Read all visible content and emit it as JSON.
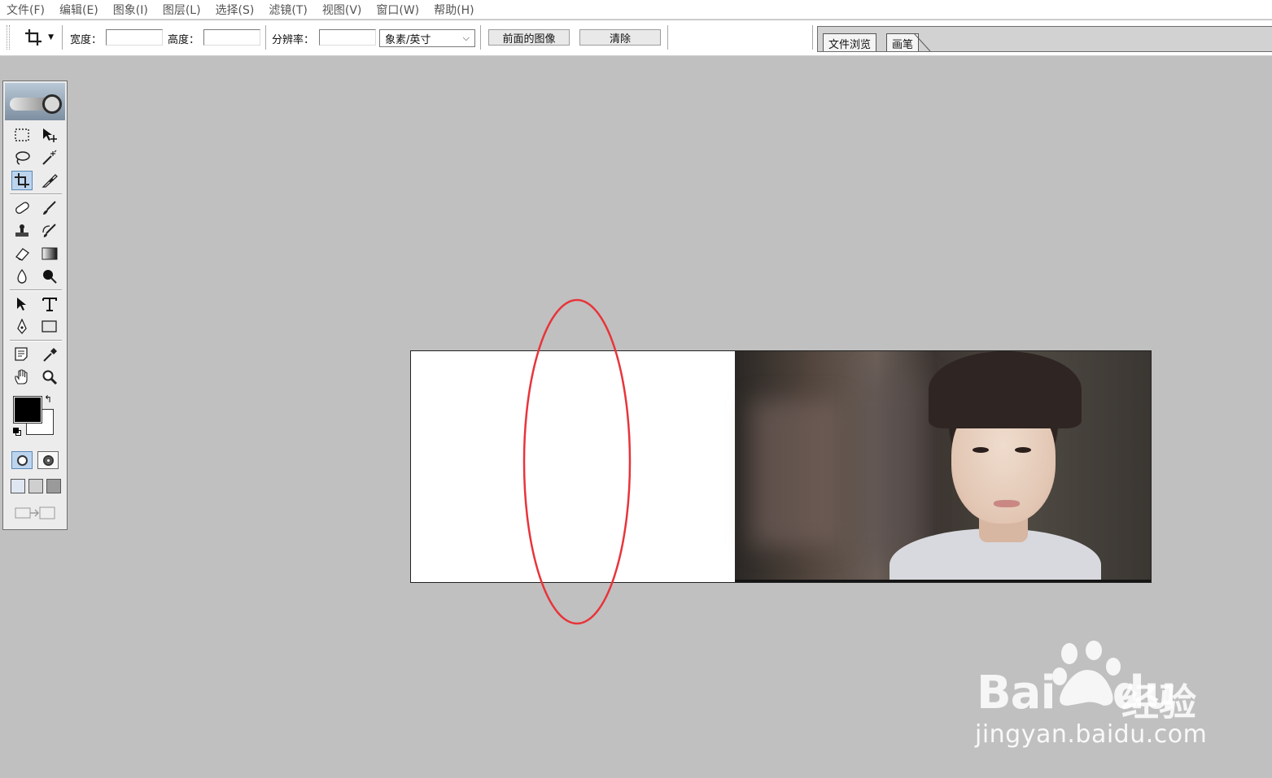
{
  "menubar": {
    "items": [
      "文件(F)",
      "编辑(E)",
      "图象(I)",
      "图层(L)",
      "选择(S)",
      "滤镜(T)",
      "视图(V)",
      "窗口(W)",
      "帮助(H)"
    ]
  },
  "options": {
    "tool_icon": "crop-icon",
    "width_label": "宽度：",
    "width_value": "",
    "height_label": "高度：",
    "height_value": "",
    "resolution_label": "分辨率：",
    "resolution_value": "",
    "unit_select": "象素/英寸",
    "front_image_button": "前面的图像",
    "clear_button": "清除"
  },
  "palette_well": {
    "tabs": [
      "文件浏览",
      "画笔"
    ]
  },
  "toolbox": {
    "tools": [
      "rectangular-marquee-icon",
      "move-icon",
      "lasso-icon",
      "magic-wand-icon",
      "crop-icon",
      "slice-icon",
      "healing-brush-icon",
      "brush-icon",
      "clone-stamp-icon",
      "history-brush-icon",
      "eraser-icon",
      "gradient-icon",
      "blur-icon",
      "dodge-icon",
      "path-selection-icon",
      "type-icon",
      "pen-icon",
      "rectangle-shape-icon",
      "notes-icon",
      "eyedropper-icon",
      "hand-icon",
      "zoom-icon"
    ],
    "active_tool": "crop-icon",
    "foreground_color": "#000000",
    "background_color": "#ffffff"
  },
  "annotation": {
    "color": "#e8343a"
  },
  "watermark": {
    "brand": "Bai",
    "brand_tail": "du",
    "cn": "经验",
    "url": "jingyan.baidu.com"
  }
}
